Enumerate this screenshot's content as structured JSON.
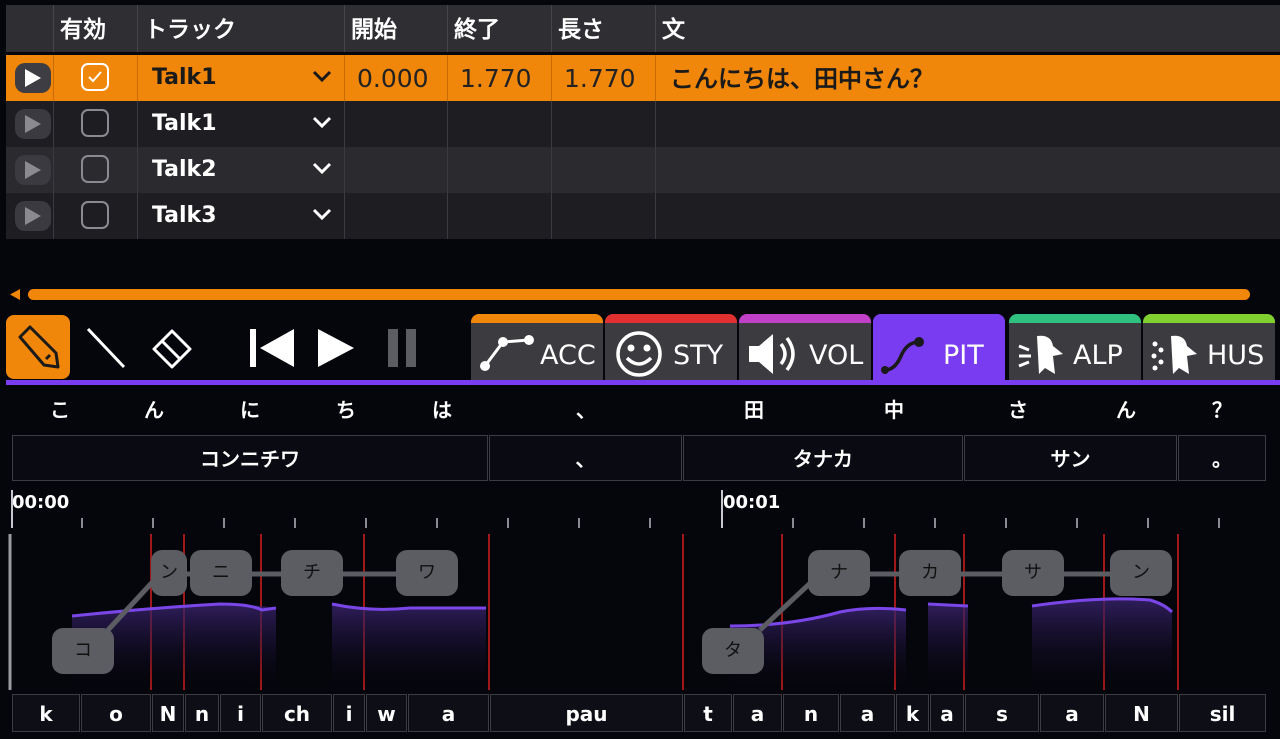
{
  "table": {
    "headers": {
      "enabled": "有効",
      "track": "トラック",
      "start": "開始",
      "end": "終了",
      "length": "長さ",
      "text": "文"
    },
    "rows": [
      {
        "track": "Talk1",
        "start": "0.000",
        "end": "1.770",
        "length": "1.770",
        "text": "こんにちは、田中さん？",
        "checked": true,
        "selected": true
      },
      {
        "track": "Talk1",
        "start": "",
        "end": "",
        "length": "",
        "text": "",
        "checked": false,
        "selected": false
      },
      {
        "track": "Talk2",
        "start": "",
        "end": "",
        "length": "",
        "text": "",
        "checked": false,
        "selected": false
      },
      {
        "track": "Talk3",
        "start": "",
        "end": "",
        "length": "",
        "text": "",
        "checked": false,
        "selected": false
      }
    ]
  },
  "tabs": [
    {
      "label": "ACC",
      "color": "#f0860a"
    },
    {
      "label": "STY",
      "color": "#e03030"
    },
    {
      "label": "VOL",
      "color": "#c040c8"
    },
    {
      "label": "PIT",
      "color": "#7a3cf0"
    },
    {
      "label": "ALP",
      "color": "#30c080"
    },
    {
      "label": "HUS",
      "color": "#80d030"
    }
  ],
  "lyrics": [
    "こ",
    "ん",
    "に",
    "ち",
    "は",
    "、",
    "田",
    "中",
    "さ",
    "ん",
    "？"
  ],
  "kana_groups": [
    "コンニチワ",
    "、",
    "タナカ",
    "サン",
    "。"
  ],
  "timeline": {
    "t0": "00:00",
    "t1": "00:01"
  },
  "notes": [
    "コ",
    "ン",
    "ニ",
    "チ",
    "ワ",
    "タ",
    "ナ",
    "カ",
    "サ",
    "ン"
  ],
  "phonemes": [
    "k",
    "o",
    "N",
    "n",
    "i",
    "ch",
    "i",
    "w",
    "a",
    "pau",
    "t",
    "a",
    "n",
    "a",
    "k",
    "a",
    "s",
    "a",
    "N",
    "sil"
  ],
  "colors": {
    "accent": "#f0860a",
    "pitch": "#7a3cf0"
  }
}
